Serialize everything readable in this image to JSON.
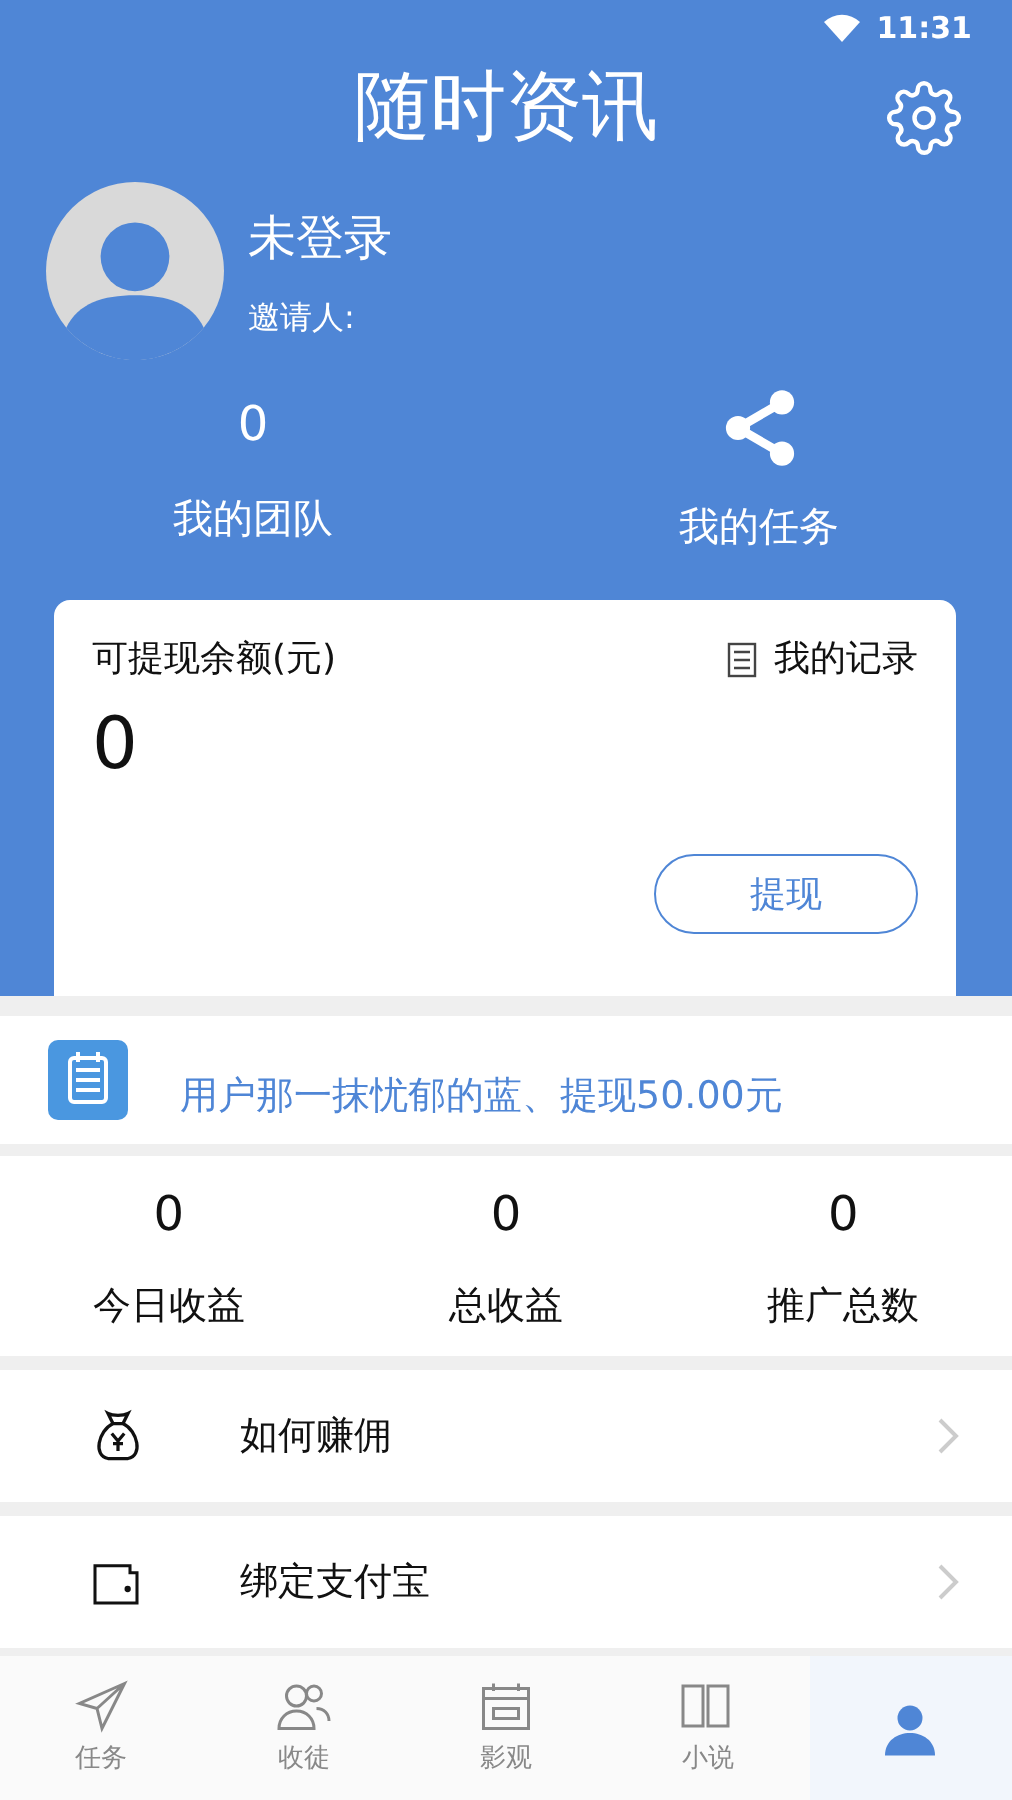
{
  "status_bar": {
    "time": "11:31"
  },
  "header": {
    "title": "随时资讯"
  },
  "profile": {
    "name": "未登录",
    "inviter_label": "邀请人:"
  },
  "summary": [
    {
      "kind": "count",
      "value": "0",
      "label": "我的团队"
    },
    {
      "kind": "share",
      "label": "我的任务"
    }
  ],
  "balance_card": {
    "label": "可提现余额(元)",
    "records_link": "我的记录",
    "amount": "0",
    "button": "提现"
  },
  "ticker": {
    "text": "用户那一抹忧郁的蓝、提现50.00元"
  },
  "stats": [
    {
      "value": "0",
      "label": "今日收益"
    },
    {
      "value": "0",
      "label": "总收益"
    },
    {
      "value": "0",
      "label": "推广总数"
    }
  ],
  "menu": [
    {
      "kind": "money",
      "label": "如何赚佣"
    },
    {
      "kind": "wallet",
      "label": "绑定支付宝"
    }
  ],
  "tabs": [
    {
      "kind": "plane",
      "label": "任务",
      "selected": false
    },
    {
      "kind": "people",
      "label": "收徒",
      "selected": false
    },
    {
      "kind": "video",
      "label": "影观",
      "selected": false
    },
    {
      "kind": "book",
      "label": "小说",
      "selected": false
    },
    {
      "kind": "me",
      "selected": true
    }
  ]
}
